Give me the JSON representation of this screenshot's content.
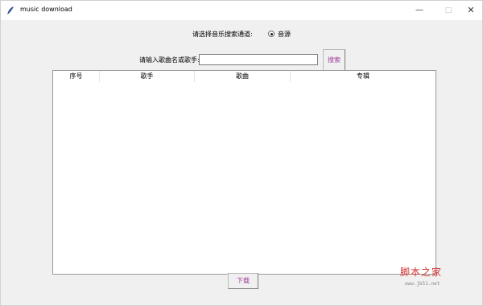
{
  "window": {
    "title": "music download",
    "app_icon": "feather-icon",
    "controls": {
      "minimize": "—",
      "maximize": "□",
      "close": "✕"
    }
  },
  "channel": {
    "label": "请选择音乐搜索通道:",
    "option_label": "音源",
    "option_selected": true
  },
  "search": {
    "label": "请输入歌曲名或歌手:",
    "value": "",
    "button_label": "搜索"
  },
  "table": {
    "columns": [
      "序号",
      "歌手",
      "歌曲",
      "专辑"
    ],
    "rows": []
  },
  "download_label": "下载",
  "watermark": {
    "main": "脚本之家",
    "sub": "www.jb51.net"
  },
  "colors": {
    "button_text": "#a03c9c",
    "watermark": "#d0312d"
  }
}
